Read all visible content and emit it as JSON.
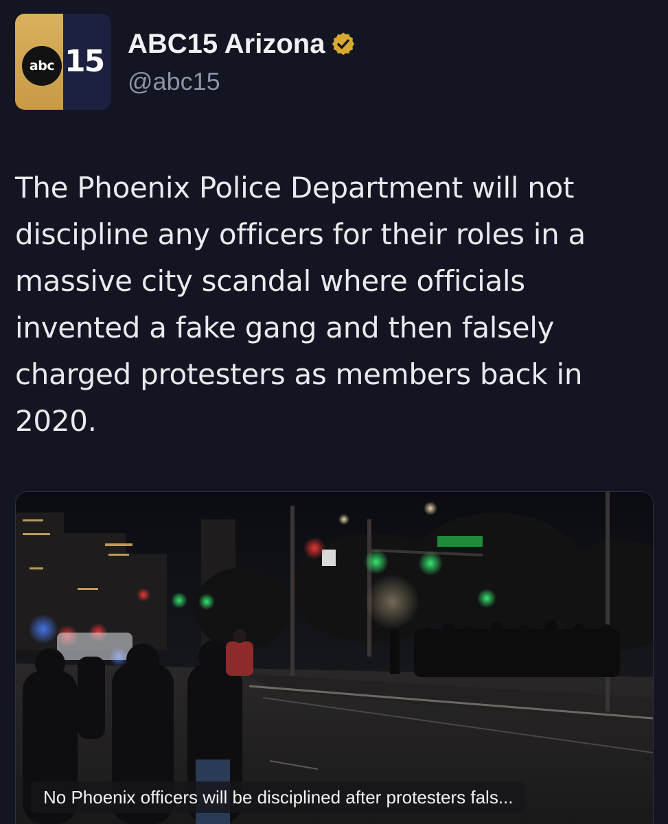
{
  "account": {
    "logo_abc": "abc",
    "logo_number": "15",
    "display_name": "ABC15 Arizona",
    "handle": "@abc15",
    "verified_icon": "verified-badge-icon",
    "verified_color": "#d8a82f"
  },
  "tweet": {
    "text": "The Phoenix Police Department will not discipline any officers for their roles in a massive city scandal where officials invented a fake gang and then falsely charged protesters as members back in 2020."
  },
  "media": {
    "caption": "No Phoenix officers will be disciplined after protesters fals..."
  },
  "colors": {
    "background": "#131523",
    "text": "#e9eaee",
    "handle": "#8b93a6",
    "logo_gold": "#d9b05c",
    "logo_navy": "#1c2140"
  }
}
